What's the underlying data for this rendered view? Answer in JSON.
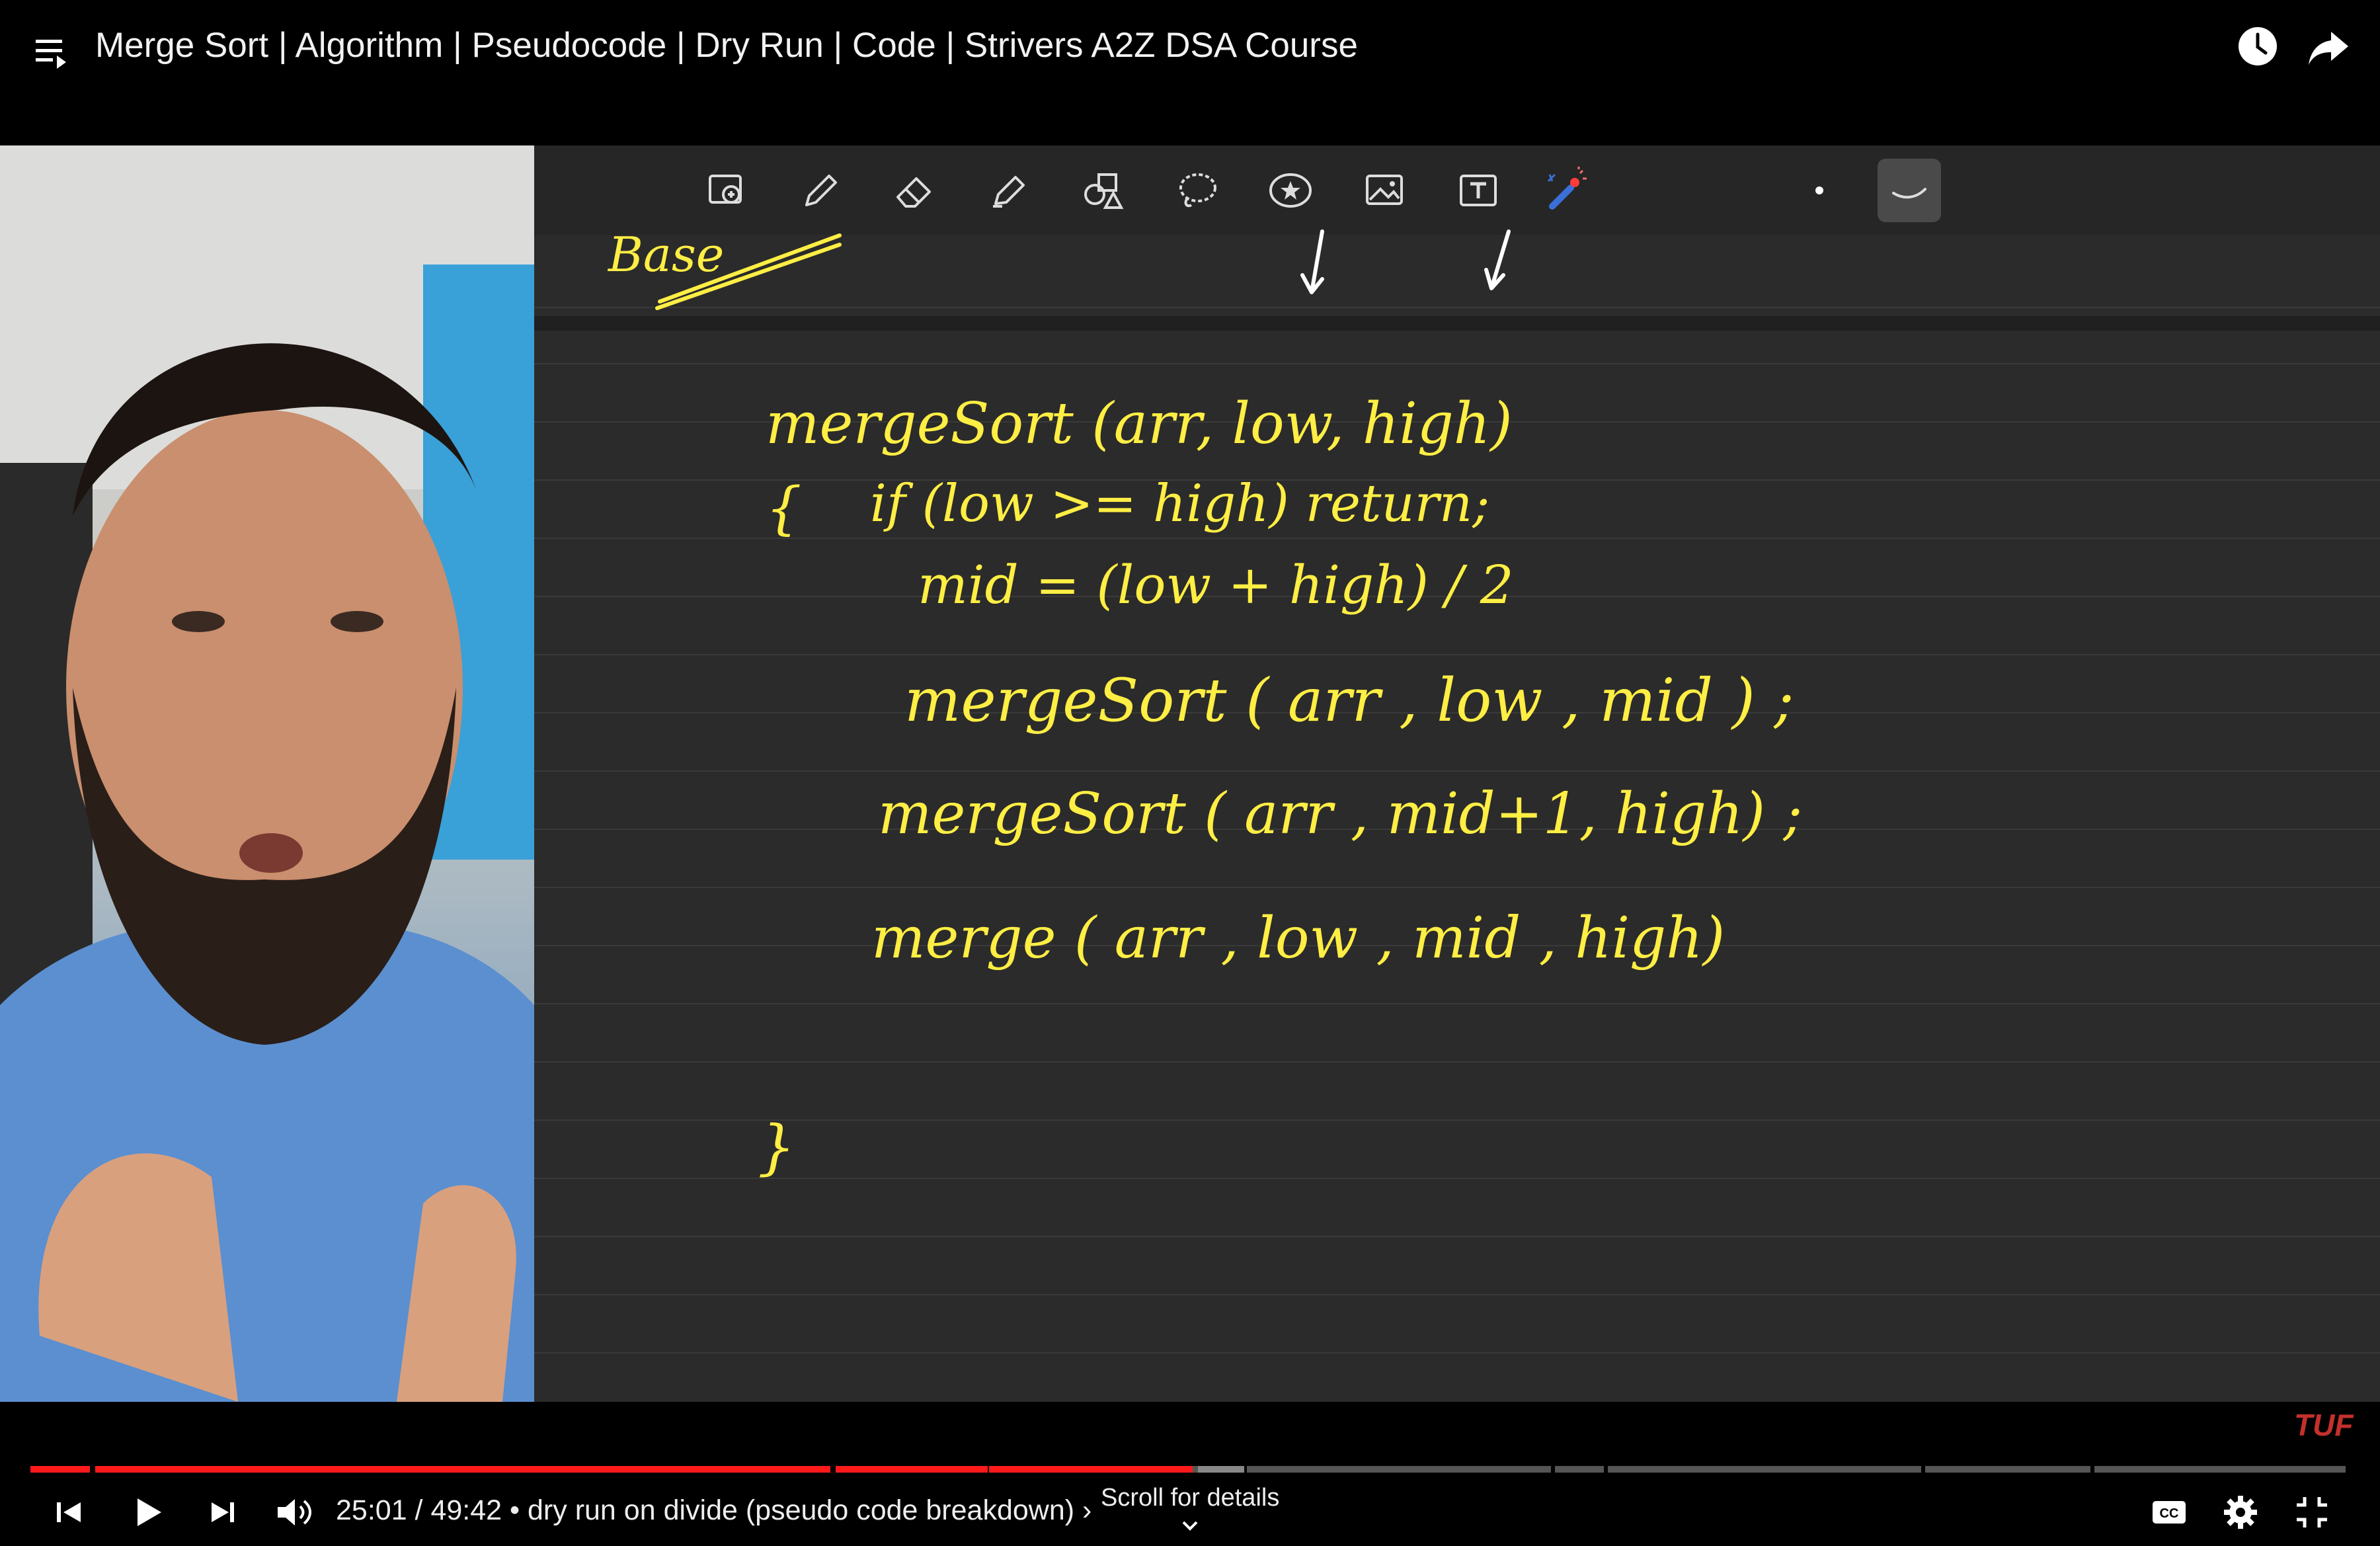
{
  "header": {
    "title": "Merge Sort | Algorithm | Pseudocode | Dry Run | Code | Strivers A2Z DSA Course"
  },
  "icons": {
    "menu": "playlist-icon",
    "watch_later": "clock-icon",
    "share": "share-arrow-icon"
  },
  "board": {
    "lines": [
      "mergeSort (arr, low, high)",
      "{",
      "if (low >= high) return;",
      "mid = (low + high) / 2",
      "mergeSort ( arr , low , mid ) ;",
      "mergeSort ( arr , mid+1, high) ;",
      "merge ( arr , low , mid , high)",
      "}"
    ],
    "partial_label": "Base",
    "pen_color": "#ffee44"
  },
  "brand": "TUF",
  "player": {
    "time": "25:01 / 49:42",
    "chapter": "• dry run on divide (pseudo code breakdown)",
    "chapter_chevron": "›",
    "scroll_hint": "Scroll for details",
    "progress_fraction": 0.5033,
    "accent": "#ff1a1a"
  }
}
